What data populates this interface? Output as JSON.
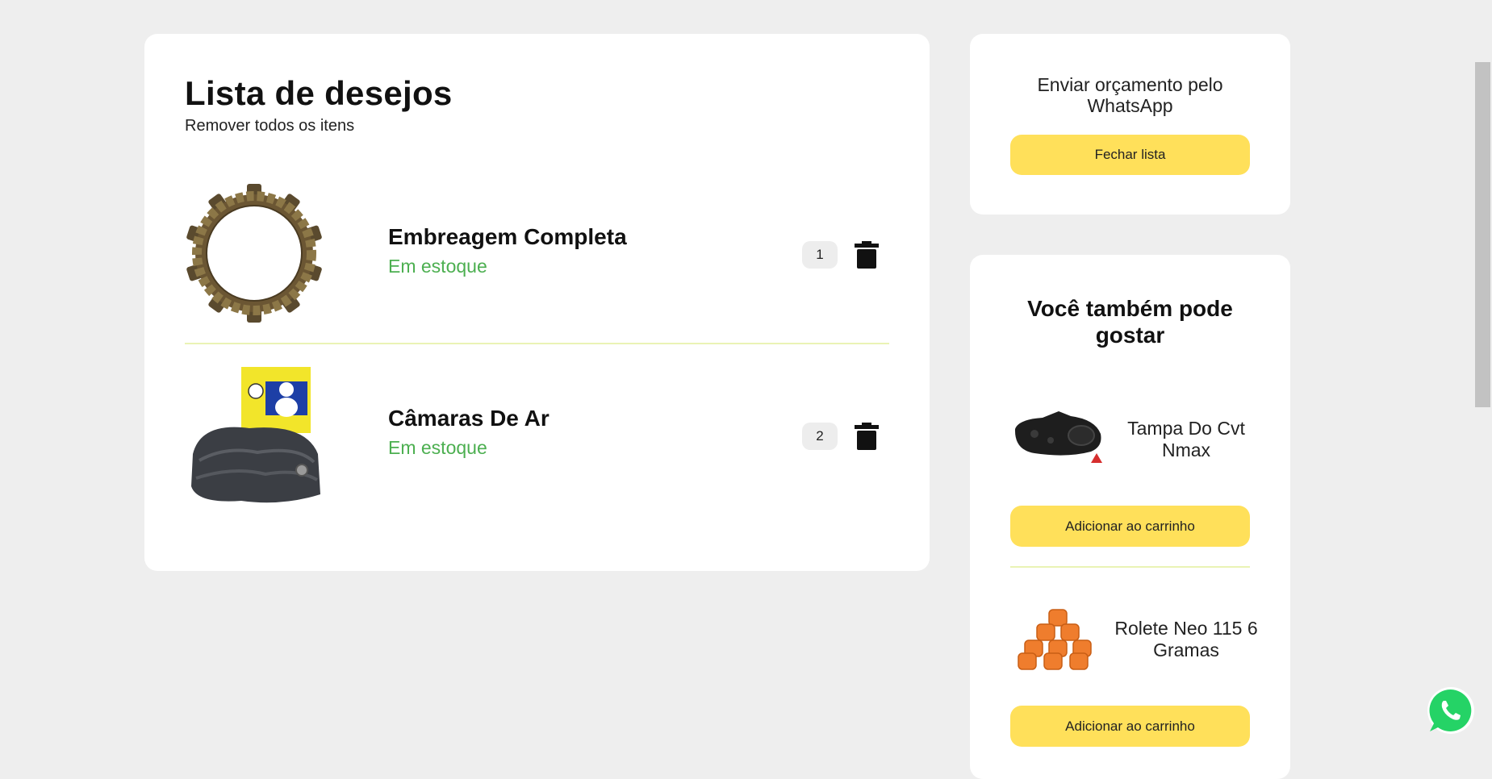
{
  "wishlist": {
    "title": "Lista de desejos",
    "remove_all_label": "Remover todos os itens",
    "items": [
      {
        "name": "Embreagem Completa",
        "stock": "Em estoque",
        "quantity": "1",
        "image_icon": "clutch-plate-image"
      },
      {
        "name": "Câmaras De Ar",
        "stock": "Em estoque",
        "quantity": "2",
        "image_icon": "inner-tube-image"
      }
    ]
  },
  "whatsapp_panel": {
    "text": "Enviar orçamento pelo WhatsApp",
    "close_label": "Fechar lista"
  },
  "suggestions": {
    "title": "Você também pode gostar",
    "items": [
      {
        "name": "Tampa Do Cvt Nmax",
        "button_label": "Adicionar ao carrinho",
        "image_icon": "cvt-cover-image"
      },
      {
        "name": "Rolete Neo 115 6 Gramas",
        "button_label": "Adicionar ao carrinho",
        "image_icon": "rollers-image"
      }
    ]
  },
  "colors": {
    "background": "#eeeeee",
    "card": "#ffffff",
    "accent_yellow": "#ffe05a",
    "stock_green": "#4caf50",
    "whatsapp_green": "#25d366",
    "divider": "#eaf3b5"
  }
}
